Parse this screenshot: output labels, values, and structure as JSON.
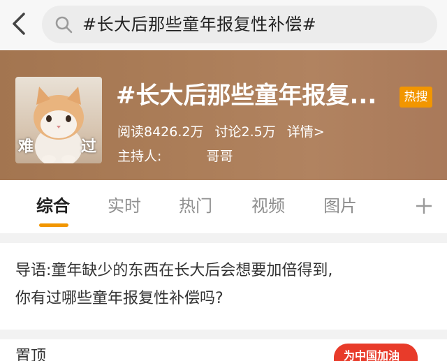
{
  "search": {
    "query": "#长大后那些童年报复性补偿#"
  },
  "topic": {
    "title": "#长大后那些童年报复...",
    "hot_badge": "热搜",
    "stats": {
      "reads": "阅读8426.2万",
      "discussions": "讨论2.5万",
      "details": "详情>"
    },
    "host_label": "主持人:",
    "host_name": "哥哥",
    "avatar": {
      "caption_left": "难",
      "caption_right": "过"
    }
  },
  "tabs": [
    {
      "label": "综合",
      "active": true
    },
    {
      "label": "实时",
      "active": false
    },
    {
      "label": "热门",
      "active": false
    },
    {
      "label": "视频",
      "active": false
    },
    {
      "label": "图片",
      "active": false
    }
  ],
  "guide": {
    "line1": "导语:童年缺少的东西在长大后会想要加倍得到,",
    "line2": "你有过哪些童年报复性补偿吗?"
  },
  "bottom": {
    "label": "置顶",
    "banner": "为中国加油"
  },
  "colors": {
    "accent": "#f29600",
    "header_bg": "#ab7d58"
  },
  "icons": [
    "back-arrow-icon",
    "search-icon",
    "plus-icon",
    "cat-avatar-icon"
  ]
}
